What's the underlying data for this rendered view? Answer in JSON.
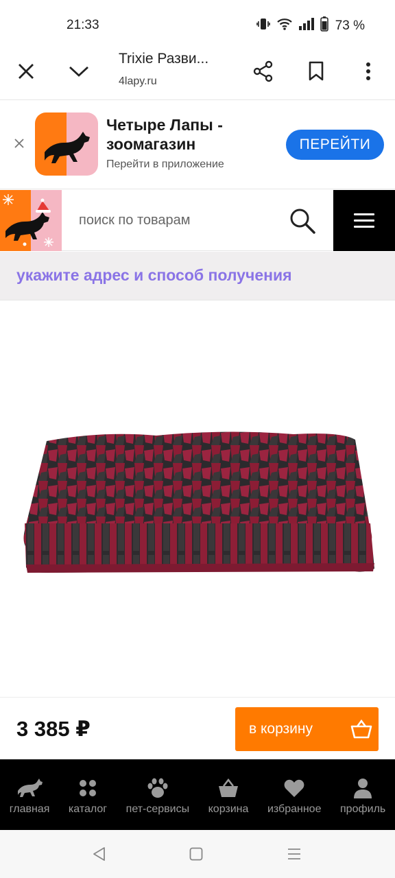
{
  "status": {
    "time": "21:33",
    "battery": "73 %"
  },
  "browser": {
    "title": "Trixie Разви...",
    "url": "4lapy.ru",
    "icons": [
      "close-icon",
      "chevron-down-icon",
      "share-icon",
      "bookmark-icon",
      "more-vert-icon"
    ]
  },
  "app_banner": {
    "name": "Четыре Лапы - зоомагазин",
    "subtitle": "Перейти в приложение",
    "button": "ПЕРЕЙТИ",
    "button_color": "#1a73e8"
  },
  "header": {
    "search_placeholder": "поиск по товарам"
  },
  "address": {
    "text": "укажите адрес и способ получения",
    "color": "#8a74e6"
  },
  "product": {
    "image_alt": "Trixie snuffle mat"
  },
  "purchase": {
    "price": "3 385 ₽",
    "cart_label": "в корзину",
    "accent": "#ff7a00"
  },
  "bottom_nav": {
    "items": [
      {
        "label": "главная",
        "icon": "dog-icon"
      },
      {
        "label": "каталог",
        "icon": "grid-icon"
      },
      {
        "label": "пет-сервисы",
        "icon": "paw-icon"
      },
      {
        "label": "корзина",
        "icon": "basket-icon"
      },
      {
        "label": "избранное",
        "icon": "heart-icon"
      },
      {
        "label": "профиль",
        "icon": "person-icon"
      }
    ]
  }
}
